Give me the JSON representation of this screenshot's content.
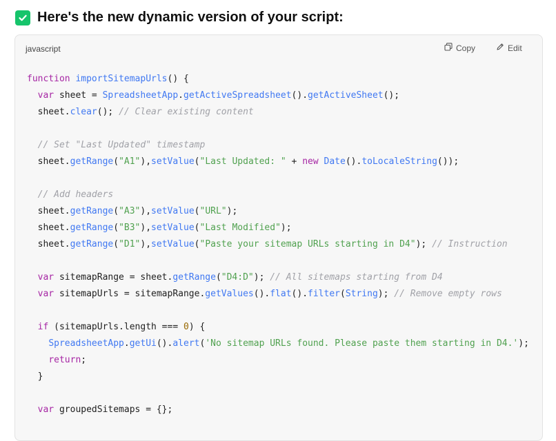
{
  "heading": {
    "text": "Here's the new dynamic version of your script:"
  },
  "code_block": {
    "language": "javascript",
    "copy_label": "Copy",
    "edit_label": "Edit",
    "lines": [
      [
        [
          "kw",
          "function "
        ],
        [
          "fn",
          "importSitemapUrls"
        ],
        [
          "p",
          "() {"
        ]
      ],
      [
        [
          "p",
          "  "
        ],
        [
          "kw",
          "var"
        ],
        [
          "p",
          " sheet = "
        ],
        [
          "fn",
          "SpreadsheetApp"
        ],
        [
          "p",
          "."
        ],
        [
          "fn",
          "getActiveSpreadsheet"
        ],
        [
          "p",
          "()."
        ],
        [
          "fn",
          "getActiveSheet"
        ],
        [
          "p",
          "();"
        ]
      ],
      [
        [
          "p",
          "  sheet."
        ],
        [
          "fn",
          "clear"
        ],
        [
          "p",
          "(); "
        ],
        [
          "cm",
          "// Clear existing content"
        ]
      ],
      [],
      [
        [
          "p",
          "  "
        ],
        [
          "cm",
          "// Set \"Last Updated\" timestamp"
        ]
      ],
      [
        [
          "p",
          "  sheet."
        ],
        [
          "fn",
          "getRange"
        ],
        [
          "p",
          "("
        ],
        [
          "str",
          "\"A1\""
        ],
        [
          "p",
          "),"
        ],
        [
          "fn",
          "setValue"
        ],
        [
          "p",
          "("
        ],
        [
          "str",
          "\"Last Updated: \""
        ],
        [
          "p",
          " + "
        ],
        [
          "kw",
          "new"
        ],
        [
          "p",
          " "
        ],
        [
          "fn",
          "Date"
        ],
        [
          "p",
          "()."
        ],
        [
          "fn",
          "toLocaleString"
        ],
        [
          "p",
          "());"
        ]
      ],
      [],
      [
        [
          "p",
          "  "
        ],
        [
          "cm",
          "// Add headers"
        ]
      ],
      [
        [
          "p",
          "  sheet."
        ],
        [
          "fn",
          "getRange"
        ],
        [
          "p",
          "("
        ],
        [
          "str",
          "\"A3\""
        ],
        [
          "p",
          "),"
        ],
        [
          "fn",
          "setValue"
        ],
        [
          "p",
          "("
        ],
        [
          "str",
          "\"URL\""
        ],
        [
          "p",
          ");"
        ]
      ],
      [
        [
          "p",
          "  sheet."
        ],
        [
          "fn",
          "getRange"
        ],
        [
          "p",
          "("
        ],
        [
          "str",
          "\"B3\""
        ],
        [
          "p",
          "),"
        ],
        [
          "fn",
          "setValue"
        ],
        [
          "p",
          "("
        ],
        [
          "str",
          "\"Last Modified\""
        ],
        [
          "p",
          ");"
        ]
      ],
      [
        [
          "p",
          "  sheet."
        ],
        [
          "fn",
          "getRange"
        ],
        [
          "p",
          "("
        ],
        [
          "str",
          "\"D1\""
        ],
        [
          "p",
          "),"
        ],
        [
          "fn",
          "setValue"
        ],
        [
          "p",
          "("
        ],
        [
          "str",
          "\"Paste your sitemap URLs starting in D4\""
        ],
        [
          "p",
          "); "
        ],
        [
          "cm",
          "// Instruction"
        ]
      ],
      [],
      [
        [
          "p",
          "  "
        ],
        [
          "kw",
          "var"
        ],
        [
          "p",
          " sitemapRange = sheet."
        ],
        [
          "fn",
          "getRange"
        ],
        [
          "p",
          "("
        ],
        [
          "str",
          "\"D4:D\""
        ],
        [
          "p",
          "); "
        ],
        [
          "cm",
          "// All sitemaps starting from D4"
        ]
      ],
      [
        [
          "p",
          "  "
        ],
        [
          "kw",
          "var"
        ],
        [
          "p",
          " sitemapUrls = sitemapRange."
        ],
        [
          "fn",
          "getValues"
        ],
        [
          "p",
          "()."
        ],
        [
          "fn",
          "flat"
        ],
        [
          "p",
          "()."
        ],
        [
          "fn",
          "filter"
        ],
        [
          "p",
          "("
        ],
        [
          "fn",
          "String"
        ],
        [
          "p",
          "); "
        ],
        [
          "cm",
          "// Remove empty rows"
        ]
      ],
      [],
      [
        [
          "p",
          "  "
        ],
        [
          "kw",
          "if"
        ],
        [
          "p",
          " (sitemapUrls.length === "
        ],
        [
          "num",
          "0"
        ],
        [
          "p",
          ") {"
        ]
      ],
      [
        [
          "p",
          "    "
        ],
        [
          "fn",
          "SpreadsheetApp"
        ],
        [
          "p",
          "."
        ],
        [
          "fn",
          "getUi"
        ],
        [
          "p",
          "()."
        ],
        [
          "fn",
          "alert"
        ],
        [
          "p",
          "("
        ],
        [
          "str",
          "'No sitemap URLs found. Please paste them starting in D4.'"
        ],
        [
          "p",
          ");"
        ]
      ],
      [
        [
          "p",
          "    "
        ],
        [
          "kw",
          "return"
        ],
        [
          "p",
          ";"
        ]
      ],
      [
        [
          "p",
          "  }"
        ]
      ],
      [],
      [
        [
          "p",
          "  "
        ],
        [
          "kw",
          "var"
        ],
        [
          "p",
          " groupedSitemaps = {};"
        ]
      ]
    ]
  },
  "colors": {
    "accent_check": "#16c46b",
    "keyword": "#a626a4",
    "function": "#4078f2",
    "string": "#50a14f",
    "comment": "#a0a1a7",
    "number": "#986801"
  },
  "icons": {
    "check": "checkbox-checked-icon",
    "copy": "copy-icon",
    "edit": "pencil-icon"
  }
}
